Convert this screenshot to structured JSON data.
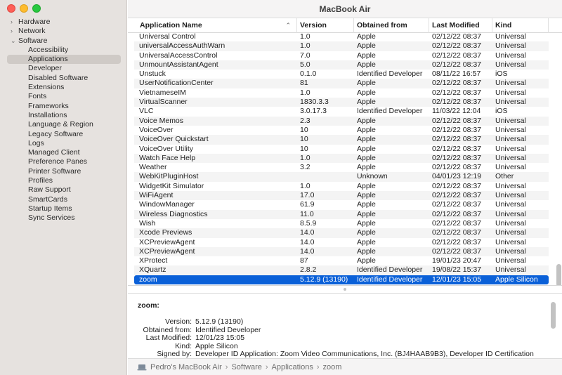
{
  "window": {
    "title": "MacBook Air"
  },
  "sidebar": {
    "items": [
      {
        "label": "Hardware",
        "level": 0,
        "chevron": "›",
        "expanded": false
      },
      {
        "label": "Network",
        "level": 0,
        "chevron": "›",
        "expanded": false
      },
      {
        "label": "Software",
        "level": 0,
        "chevron": "⌄",
        "expanded": true
      },
      {
        "label": "Accessibility",
        "level": 1
      },
      {
        "label": "Applications",
        "level": 1,
        "selected": true
      },
      {
        "label": "Developer",
        "level": 1
      },
      {
        "label": "Disabled Software",
        "level": 1
      },
      {
        "label": "Extensions",
        "level": 1
      },
      {
        "label": "Fonts",
        "level": 1
      },
      {
        "label": "Frameworks",
        "level": 1
      },
      {
        "label": "Installations",
        "level": 1
      },
      {
        "label": "Language & Region",
        "level": 1
      },
      {
        "label": "Legacy Software",
        "level": 1
      },
      {
        "label": "Logs",
        "level": 1
      },
      {
        "label": "Managed Client",
        "level": 1
      },
      {
        "label": "Preference Panes",
        "level": 1
      },
      {
        "label": "Printer Software",
        "level": 1
      },
      {
        "label": "Profiles",
        "level": 1
      },
      {
        "label": "Raw Support",
        "level": 1
      },
      {
        "label": "SmartCards",
        "level": 1
      },
      {
        "label": "Startup Items",
        "level": 1
      },
      {
        "label": "Sync Services",
        "level": 1
      }
    ]
  },
  "table": {
    "columns": {
      "name": "Application Name",
      "version": "Version",
      "obtained": "Obtained from",
      "modified": "Last Modified",
      "kind": "Kind"
    },
    "sort_indicator": "⌃",
    "rows": [
      [
        "Universal Control",
        "1.0",
        "Apple",
        "02/12/22 08:37",
        "Universal"
      ],
      [
        "universalAccessAuthWarn",
        "1.0",
        "Apple",
        "02/12/22 08:37",
        "Universal"
      ],
      [
        "UniversalAccessControl",
        "7.0",
        "Apple",
        "02/12/22 08:37",
        "Universal"
      ],
      [
        "UnmountAssistantAgent",
        "5.0",
        "Apple",
        "02/12/22 08:37",
        "Universal"
      ],
      [
        "Unstuck",
        "0.1.0",
        "Identified Developer",
        "08/11/22 16:57",
        "iOS"
      ],
      [
        "UserNotificationCenter",
        "81",
        "Apple",
        "02/12/22 08:37",
        "Universal"
      ],
      [
        "VietnameseIM",
        "1.0",
        "Apple",
        "02/12/22 08:37",
        "Universal"
      ],
      [
        "VirtualScanner",
        "1830.3.3",
        "Apple",
        "02/12/22 08:37",
        "Universal"
      ],
      [
        "VLC",
        "3.0.17.3",
        "Identified Developer",
        "11/03/22 12:04",
        "iOS"
      ],
      [
        "Voice Memos",
        "2.3",
        "Apple",
        "02/12/22 08:37",
        "Universal"
      ],
      [
        "VoiceOver",
        "10",
        "Apple",
        "02/12/22 08:37",
        "Universal"
      ],
      [
        "VoiceOver Quickstart",
        "10",
        "Apple",
        "02/12/22 08:37",
        "Universal"
      ],
      [
        "VoiceOver Utility",
        "10",
        "Apple",
        "02/12/22 08:37",
        "Universal"
      ],
      [
        "Watch Face Help",
        "1.0",
        "Apple",
        "02/12/22 08:37",
        "Universal"
      ],
      [
        "Weather",
        "3.2",
        "Apple",
        "02/12/22 08:37",
        "Universal"
      ],
      [
        "WebKitPluginHost",
        "",
        "Unknown",
        "04/01/23 12:19",
        "Other"
      ],
      [
        "WidgetKit Simulator",
        "1.0",
        "Apple",
        "02/12/22 08:37",
        "Universal"
      ],
      [
        "WiFiAgent",
        "17.0",
        "Apple",
        "02/12/22 08:37",
        "Universal"
      ],
      [
        "WindowManager",
        "61.9",
        "Apple",
        "02/12/22 08:37",
        "Universal"
      ],
      [
        "Wireless Diagnostics",
        "11.0",
        "Apple",
        "02/12/22 08:37",
        "Universal"
      ],
      [
        "Wish",
        "8.5.9",
        "Apple",
        "02/12/22 08:37",
        "Universal"
      ],
      [
        "Xcode Previews",
        "14.0",
        "Apple",
        "02/12/22 08:37",
        "Universal"
      ],
      [
        "XCPreviewAgent",
        "14.0",
        "Apple",
        "02/12/22 08:37",
        "Universal"
      ],
      [
        "XCPreviewAgent",
        "14.0",
        "Apple",
        "02/12/22 08:37",
        "Universal"
      ],
      [
        "XProtect",
        "87",
        "Apple",
        "19/01/23 20:47",
        "Universal"
      ],
      [
        "XQuartz",
        "2.8.2",
        "Identified Developer",
        "19/08/22 15:37",
        "Universal"
      ],
      [
        "zoom",
        "5.12.9 (13190)",
        "Identified Developer",
        "12/01/23 15:05",
        "Apple Silicon"
      ]
    ],
    "selected_index": 26
  },
  "detail": {
    "title": "zoom:",
    "fields": [
      {
        "label": "Version:",
        "value": "5.12.9 (13190)"
      },
      {
        "label": "Obtained from:",
        "value": "Identified Developer"
      },
      {
        "label": "Last Modified:",
        "value": "12/01/23 15:05"
      },
      {
        "label": "Kind:",
        "value": "Apple Silicon"
      },
      {
        "label": "Signed by:",
        "value": "Developer ID Application: Zoom Video Communications, Inc. (BJ4HAAB9B3), Developer ID Certification"
      }
    ]
  },
  "pathbar": {
    "icon": "laptop-icon",
    "crumbs": [
      "Pedro's MacBook Air",
      "Software",
      "Applications",
      "zoom"
    ],
    "separator": "›"
  },
  "colors": {
    "selection": "#0a60d8",
    "sidebar_bg": "#e6e2df",
    "sidebar_selected": "#cfcac6"
  }
}
